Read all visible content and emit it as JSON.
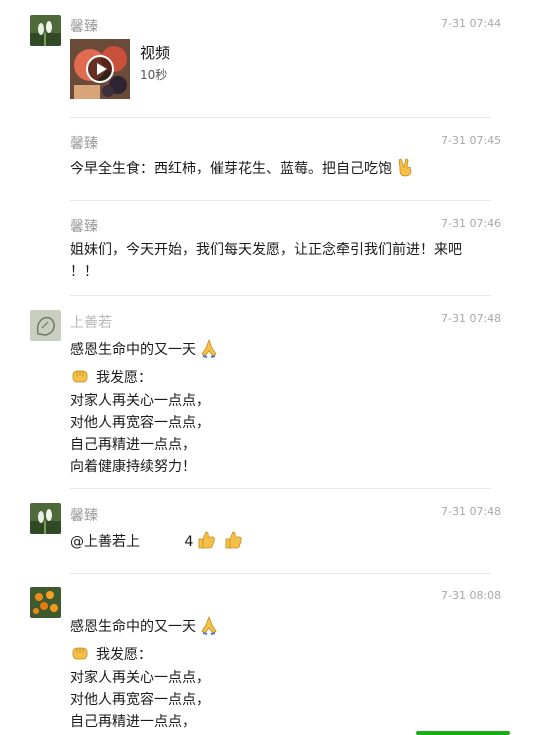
{
  "messages": [
    {
      "sender": "馨臻",
      "time": "7-31 07:44",
      "type": "video",
      "video_title": "视频",
      "video_duration": "10秒"
    },
    {
      "sender": "馨臻",
      "time": "7-31 07:45",
      "text": "今早全生食：西红柿，催芽花生、蓝莓。把自己吃饱",
      "emoji": "victory-hand-icon"
    },
    {
      "sender": "馨臻",
      "time": "7-31 07:46",
      "lines": [
        "姐妹们，今天开始，我们每天发愿，让正念牵引我们前进！来吧",
        "！！"
      ]
    },
    {
      "sender": "上善若",
      "time": "7-31 07:48",
      "first": "感恩生命中的又一天",
      "vow": "我发愿：",
      "lines": [
        "对家人再关心一点点，",
        "对他人再宽容一点点，",
        "自己再精进一点点，",
        "向着健康持续努力！"
      ]
    },
    {
      "sender": "馨臻",
      "time": "7-31 07:48",
      "mention": "@上善若上",
      "suffix": "4"
    },
    {
      "sender": "",
      "time": "7-31 08:08",
      "first": "感恩生命中的又一天",
      "vow": "我发愿：",
      "lines": [
        "对家人再关心一点点，",
        "对他人再宽容一点点，",
        "自己再精进一点点，"
      ]
    }
  ],
  "colors": {
    "name": "#9b9b9b",
    "time": "#a8a8a8",
    "text": "#1a1a1a",
    "divider": "#e7e7e7",
    "accent": "#1aad19"
  }
}
